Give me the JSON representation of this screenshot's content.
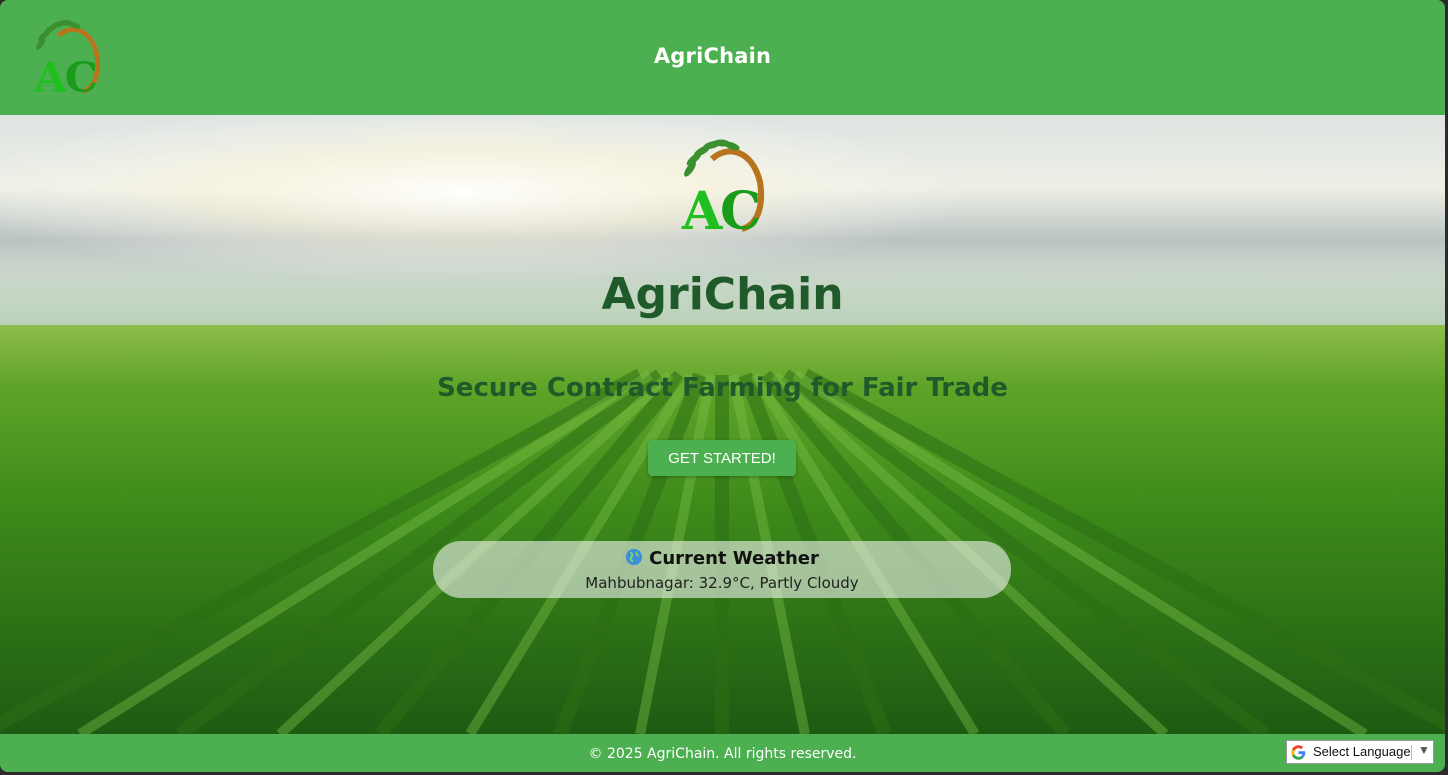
{
  "header": {
    "title": "AgriChain",
    "logo_icon": "agrichain-logo-icon"
  },
  "hero": {
    "title": "AgriChain",
    "subtitle": "Secure Contract Farming for Fair Trade",
    "cta_label": "GET STARTED!",
    "logo_icon": "agrichain-logo-icon"
  },
  "weather": {
    "icon": "globe-icon",
    "heading": "Current Weather",
    "details": "Mahbubnagar: 32.9°C, Partly Cloudy"
  },
  "footer": {
    "copyright": "© 2025 AgriChain. All rights reserved."
  },
  "translate": {
    "label": "Select Language",
    "icon": "google-g-icon",
    "arrow": "▼"
  },
  "colors": {
    "brand_green": "#4caf50",
    "title_green": "#1f5a2a"
  }
}
